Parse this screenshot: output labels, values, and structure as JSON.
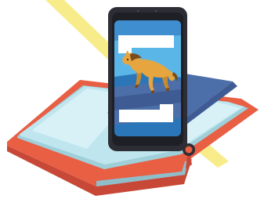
{
  "illustration": {
    "subject": "augmented-reality-book",
    "elements": {
      "book": "open-book-icon",
      "phone": "smartphone-icon",
      "horse": "horse-icon",
      "screen_graphic": "ar-screen-icon",
      "light_beam": "light-beam-icon",
      "bookmark": "bookmark-icon"
    },
    "colors": {
      "book_cover": "#e85f44",
      "book_cover_shadow": "#c74836",
      "book_page": "#bfe5ee",
      "book_page_inner": "#d7f1f6",
      "book_page_edge": "#9fd0da",
      "book_page_shadow": "#8fbecb",
      "book_panel": "#4d6fa9",
      "book_panel_dark": "#3f5b93",
      "phone_body": "#2d2d35",
      "phone_bezel": "#1f1f26",
      "screen_bg": "#2b76b8",
      "screen_triangle_light": "#5bb6e8",
      "screen_triangle_mid": "#3f8fd0",
      "screen_white": "#ffffff",
      "horse_body": "#e7a53f",
      "horse_shadow": "#c98a2d",
      "horse_mane": "#7a4b1c",
      "beam": "#f8ec8a"
    }
  }
}
